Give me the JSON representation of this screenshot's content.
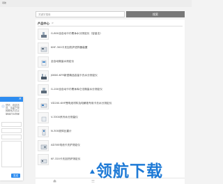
{
  "header": {
    "logo_text": "领航"
  },
  "search": {
    "placeholder": "关键字搜索",
    "button_label": "搜索"
  },
  "panel": {
    "title": "产品中心",
    "more": ">"
  },
  "products": [
    {
      "label": "G-800全自动卡尔费休水分测定仪（容量法）",
      "icon": "titrator-icon"
    },
    {
      "label": "KHF-300卡氏加热炉进样器装置",
      "icon": "oven-icon"
    },
    {
      "label": "全自动微量水测定仪",
      "icon": "analyzer-icon"
    },
    {
      "label": "J0800-KFR新型精品容量卡氏水分测定仪",
      "icon": "titrator-icon"
    },
    {
      "label": "G-200全自动卡尔费休库仑法微量水分测定仪",
      "icon": "titrator-icon"
    },
    {
      "label": "VD200-KHF锂电池材料及电解液专用卡氏水分测定仪",
      "icon": "analyzer-icon"
    },
    {
      "label": "V-3300系列水分测量仪",
      "icon": "instrument-icon"
    },
    {
      "label": "N-300液体比重计",
      "icon": "meter-icon"
    },
    {
      "label": "AD300电池卡氏炉测定仪",
      "icon": "oven-icon"
    },
    {
      "label": "KF-320卡氏加热炉测定仪",
      "icon": "oven-icon"
    }
  ],
  "chat": {
    "close": "×",
    "message": "您好，欢迎访问，请留下您的联系方式以便我们为您服务，我们会尽快与您联系。",
    "send_label": "发送"
  },
  "watermark": {
    "text": "领航下载"
  },
  "colors": {
    "accent": "#2d8cf0",
    "watermark": "#1e7ad6",
    "search_button": "#777777"
  }
}
